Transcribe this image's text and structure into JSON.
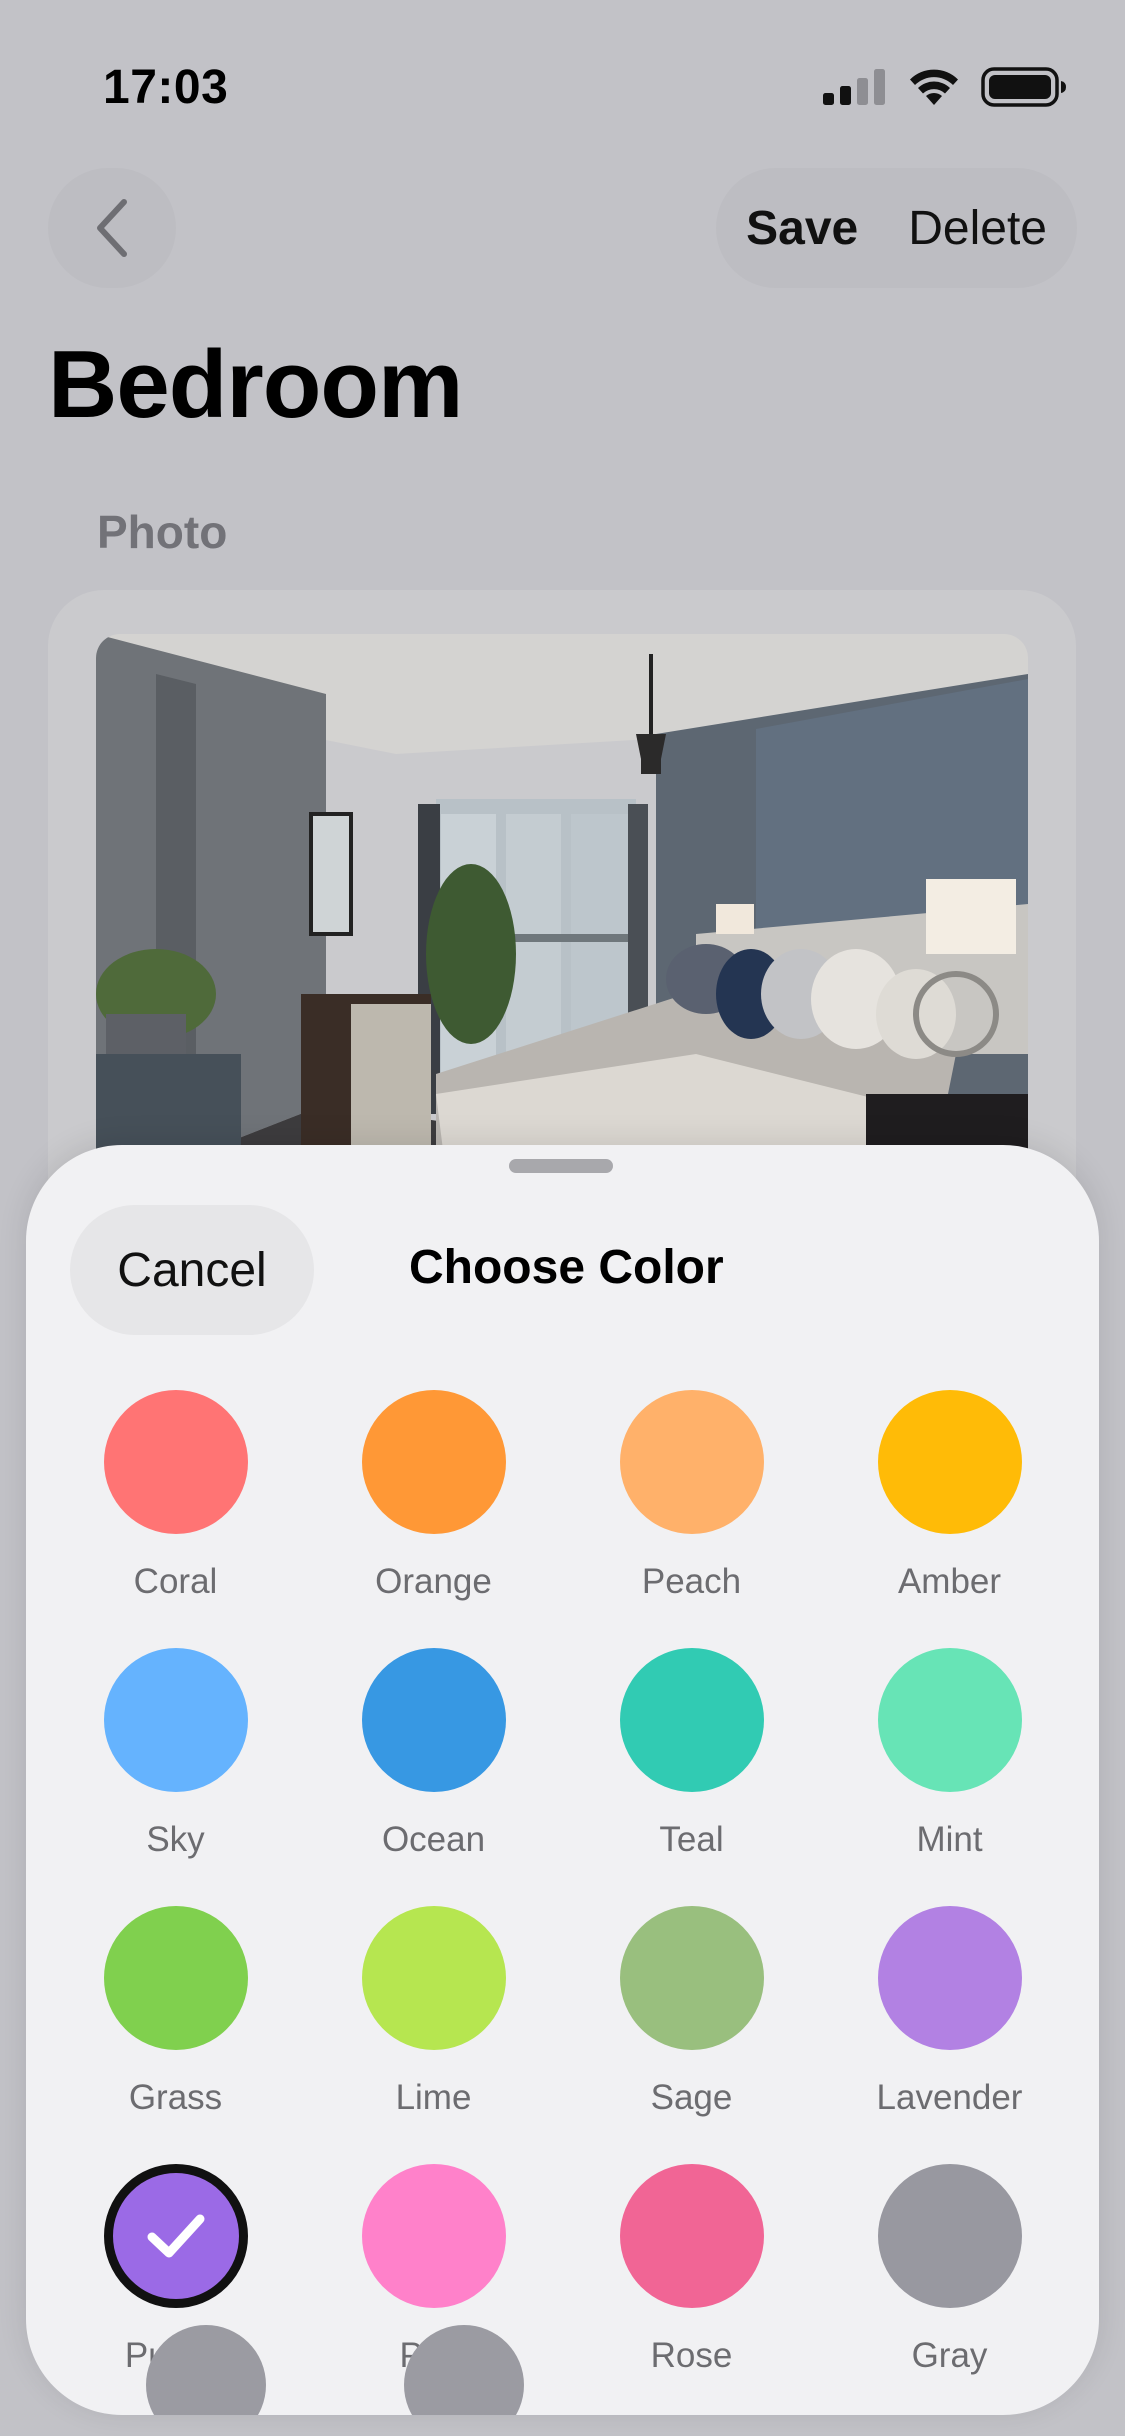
{
  "status_bar": {
    "time": "17:03"
  },
  "nav": {
    "save_label": "Save",
    "delete_label": "Delete"
  },
  "page": {
    "title": "Bedroom",
    "photo_section_label": "Photo"
  },
  "sheet": {
    "cancel_label": "Cancel",
    "title": "Choose Color",
    "colors": [
      {
        "label": "Coral",
        "hex": "#ff7474"
      },
      {
        "label": "Orange",
        "hex": "#ff9836"
      },
      {
        "label": "Peach",
        "hex": "#ffb16a"
      },
      {
        "label": "Amber",
        "hex": "#ffbb07"
      },
      {
        "label": "Sky",
        "hex": "#65b3fe"
      },
      {
        "label": "Ocean",
        "hex": "#3798e3"
      },
      {
        "label": "Teal",
        "hex": "#31cbb3"
      },
      {
        "label": "Mint",
        "hex": "#67e4b6"
      },
      {
        "label": "Grass",
        "hex": "#80d04e"
      },
      {
        "label": "Lime",
        "hex": "#b6e650"
      },
      {
        "label": "Sage",
        "hex": "#99bf7e"
      },
      {
        "label": "Lavender",
        "hex": "#b281e3"
      },
      {
        "label": "Purple",
        "hex": "#9b6ae6",
        "selected": true
      },
      {
        "label": "Pink",
        "hex": "#ff81ca"
      },
      {
        "label": "Rose",
        "hex": "#f16595"
      },
      {
        "label": "Gray",
        "hex": "#9898a0"
      }
    ]
  },
  "icons": {
    "back": "chevron-left-icon",
    "check": "checkmark-icon",
    "signal": "cellular-signal-icon",
    "wifi": "wifi-icon",
    "battery": "battery-icon"
  }
}
